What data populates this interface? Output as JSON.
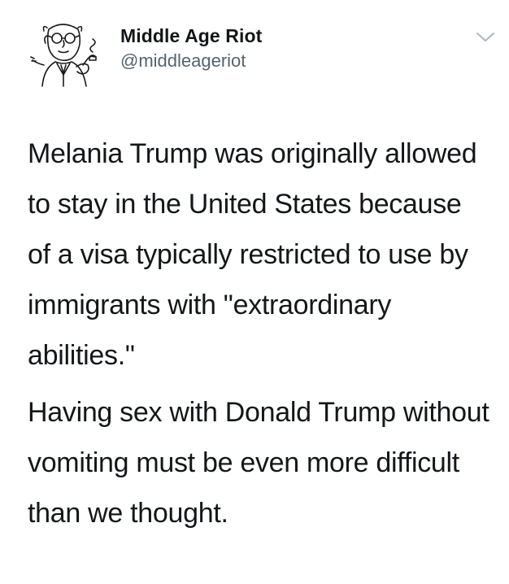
{
  "tweet": {
    "author": {
      "display_name": "Middle Age Riot",
      "handle": "@middleageriot",
      "avatar_icon": "cartoon-man-with-pipe-avatar"
    },
    "menu_icon": "chevron-down-icon",
    "paragraphs": [
      "Melania Trump was originally allowed to stay in the United States because of a visa typically restricted to use by immigrants with \"extraordinary abilities.\"",
      "Having sex with Donald Trump without vomiting must be even more difficult than we thought."
    ]
  },
  "colors": {
    "text": "#14171a",
    "secondary_text": "#536471",
    "chevron": "#aab8c2",
    "background": "#ffffff"
  }
}
